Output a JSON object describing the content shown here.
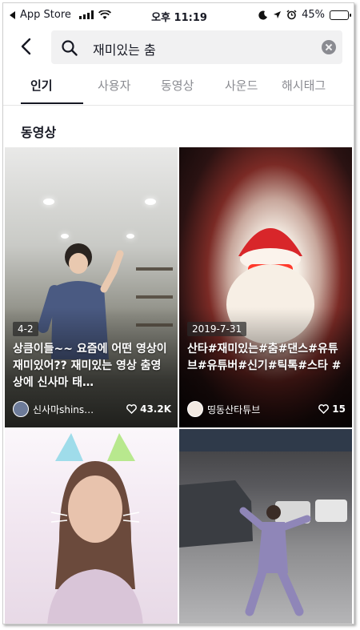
{
  "status_bar": {
    "carrier": "App Store",
    "time": "오후 11:19",
    "battery": "45%",
    "battery_level": 0.45
  },
  "search": {
    "query": "재미있는 춤"
  },
  "tabs": [
    {
      "label": "인기",
      "active": true
    },
    {
      "label": "사용자",
      "active": false
    },
    {
      "label": "동영상",
      "active": false
    },
    {
      "label": "사운드",
      "active": false
    },
    {
      "label": "해시태그",
      "active": false
    }
  ],
  "section_title": "동영상",
  "videos": [
    {
      "date": "4-2",
      "caption": "상큼이들~~ 요즘에 어떤 영상이 재미있어?? 재미있는 영상 춤영상에 신사마 태…",
      "author": "신사마shins…",
      "likes": "43.2K"
    },
    {
      "date": "2019-7-31",
      "caption": "산타#재미있는#춤#댄스#유튜브#유튜버#신기#틱톡#스타 #",
      "author": "띵동산타튜브",
      "likes": "15"
    },
    {
      "date": "",
      "caption": "",
      "author": "",
      "likes": ""
    },
    {
      "date": "",
      "caption": "",
      "author": "",
      "likes": ""
    }
  ]
}
